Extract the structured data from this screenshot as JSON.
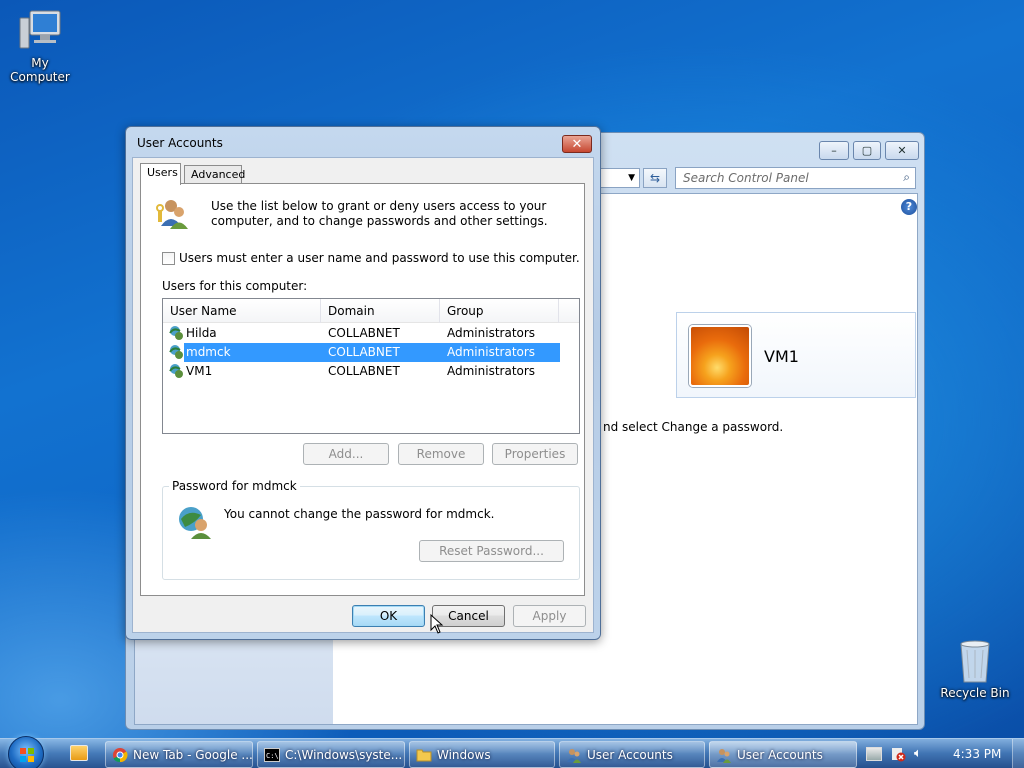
{
  "desktop": {
    "icons": [
      {
        "label": "My Computer"
      },
      {
        "label": "Recycle Bin"
      }
    ]
  },
  "control_panel": {
    "search_placeholder": "Search Control Panel",
    "user_tile_name": "VM1",
    "partial_text": "nd select Change a password."
  },
  "dialog": {
    "title": "User Accounts",
    "tabs": [
      {
        "label": "Users"
      },
      {
        "label": "Advanced"
      }
    ],
    "intro": "Use the list below to grant or deny users access to your computer, and to change passwords and other settings.",
    "must_enter_label": "Users must enter a user name and password to use this computer.",
    "must_enter_checked": false,
    "users_label": "Users for this computer:",
    "columns": [
      "User Name",
      "Domain",
      "Group"
    ],
    "rows": [
      {
        "name": "Hilda",
        "domain": "COLLABNET",
        "group": "Administrators"
      },
      {
        "name": "mdmck",
        "domain": "COLLABNET",
        "group": "Administrators"
      },
      {
        "name": "VM1",
        "domain": "COLLABNET",
        "group": "Administrators"
      }
    ],
    "selected_row": 1,
    "buttons": {
      "add": "Add...",
      "remove": "Remove",
      "properties": "Properties"
    },
    "password_group": {
      "title": "Password for mdmck",
      "message": "You cannot change the password for mdmck.",
      "reset_button": "Reset Password..."
    },
    "footer": {
      "ok": "OK",
      "cancel": "Cancel",
      "apply": "Apply"
    }
  },
  "taskbar": {
    "items": [
      {
        "label": "New Tab - Google ..."
      },
      {
        "label": "C:\\Windows\\syste..."
      },
      {
        "label": "Windows"
      },
      {
        "label": "User Accounts"
      },
      {
        "label": "User Accounts"
      }
    ],
    "clock": "4:33 PM"
  }
}
